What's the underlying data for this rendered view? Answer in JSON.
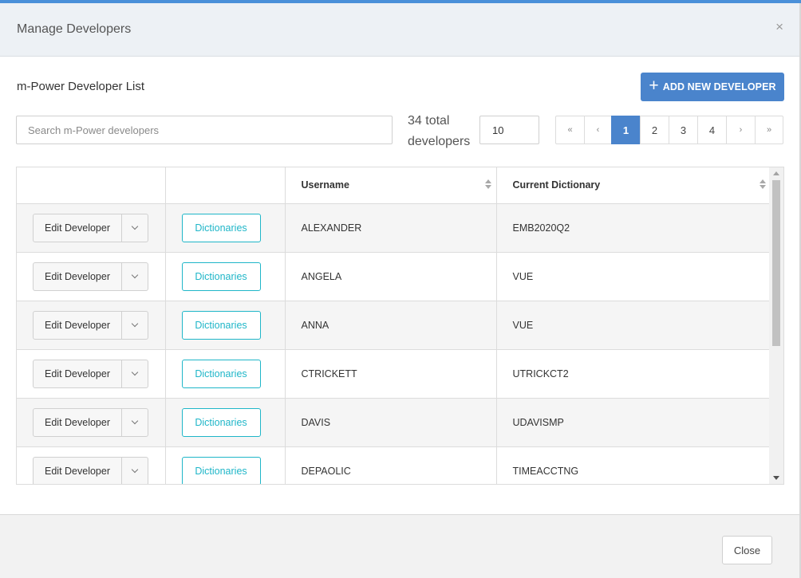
{
  "dialog": {
    "title": "Manage Developers",
    "close_icon": "close-icon",
    "close_glyph": "×"
  },
  "list": {
    "title": "m-Power Developer List",
    "add_button_label": "ADD NEW DEVELOPER",
    "add_icon": "plus-icon",
    "add_glyph": "+"
  },
  "search": {
    "placeholder": "Search m-Power developers",
    "value": ""
  },
  "total": {
    "line1": "34 total",
    "line2": "developers"
  },
  "page_size": "10",
  "pagination": {
    "first": "«",
    "prev": "‹",
    "pages": [
      "1",
      "2",
      "3",
      "4"
    ],
    "active_page": "1",
    "next": "›",
    "last": "»"
  },
  "table": {
    "columns": [
      "",
      "",
      "Username",
      "Current Dictionary"
    ],
    "sortable_columns": [
      "Username",
      "Current Dictionary"
    ],
    "edit_label": "Edit Developer",
    "dictionaries_label": "Dictionaries",
    "rows": [
      {
        "username": "ALEXANDER",
        "dictionary": "EMB2020Q2"
      },
      {
        "username": "ANGELA",
        "dictionary": "VUE"
      },
      {
        "username": "ANNA",
        "dictionary": "VUE"
      },
      {
        "username": "CTRICKETT",
        "dictionary": "UTRICKCT2"
      },
      {
        "username": "DAVIS",
        "dictionary": "UDAVISMP"
      },
      {
        "username": "DEPAOLIC",
        "dictionary": "TIMEACCTNG"
      }
    ]
  },
  "footer": {
    "close_label": "Close"
  },
  "colors": {
    "accent": "#4a84cc",
    "teal": "#1fb6c8",
    "header_bg": "#edf1f5"
  }
}
